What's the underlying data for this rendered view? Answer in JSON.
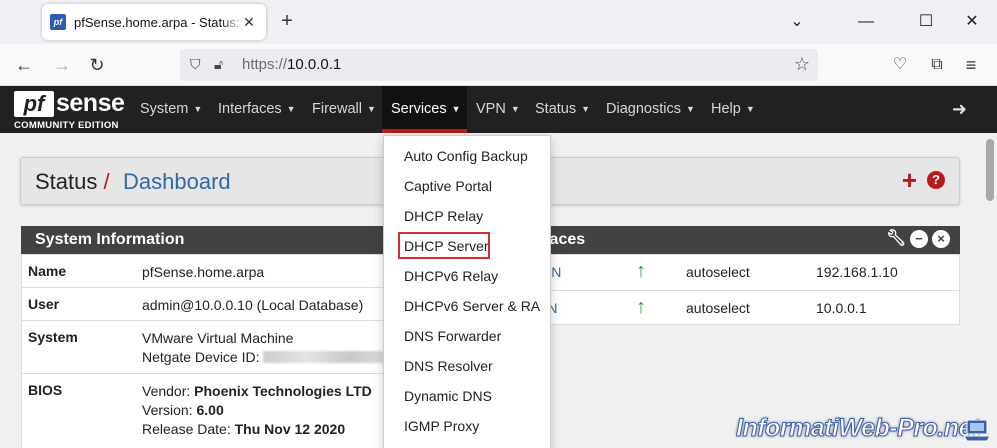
{
  "browser": {
    "tab_title": "pfSense.home.arpa - Status: Dashboard",
    "favicon_text": "pf",
    "url_proto": "https://",
    "url_host": "10.0.0.1",
    "icons": [
      "back-icon",
      "forward-icon",
      "reload-icon",
      "shield-icon",
      "lock-icon",
      "star-icon",
      "pocket-icon",
      "extensions-icon",
      "menu-icon"
    ]
  },
  "logo": {
    "pf": "pf",
    "sense": "sense",
    "edition": "COMMUNITY EDITION"
  },
  "nav": {
    "items": [
      "System",
      "Interfaces",
      "Firewall",
      "Services",
      "VPN",
      "Status",
      "Diagnostics",
      "Help"
    ],
    "active": "Services"
  },
  "breadcrumb": {
    "section": "Status",
    "separator": "/",
    "page": "Dashboard"
  },
  "system_info": {
    "title": "System Information",
    "rows": [
      {
        "label": "Name",
        "value": "pfSense.home.arpa"
      },
      {
        "label": "User",
        "value": "admin@10.0.0.10 (Local Database)"
      },
      {
        "label": "System",
        "line1": "VMware Virtual Machine",
        "line2": "Netgate Device ID:"
      },
      {
        "label": "BIOS",
        "vendor_label": "Vendor: ",
        "vendor": "Phoenix Technologies LTD",
        "version_label": "Version: ",
        "version": "6.00",
        "release_label": "Release Date: ",
        "release": "Thu Nov 12 2020"
      }
    ]
  },
  "interfaces": {
    "title": "Interfaces",
    "title_visible": "rfaces",
    "rows": [
      {
        "name": "WAN",
        "name_visible": "/AN",
        "media": "autoselect",
        "ip": "192.168.1.10"
      },
      {
        "name": "LAN",
        "name_visible": "AN",
        "media": "autoselect",
        "ip": "10.0.0.1"
      }
    ]
  },
  "services_menu": {
    "items": [
      "Auto Config Backup",
      "Captive Portal",
      "DHCP Relay",
      "DHCP Server",
      "DHCPv6 Relay",
      "DHCPv6 Server & RA",
      "DNS Forwarder",
      "DNS Resolver",
      "Dynamic DNS",
      "IGMP Proxy"
    ],
    "highlighted": "DHCP Server"
  },
  "watermark": "InformatiWeb-Pro.net",
  "colors": {
    "nav_bg": "#212121",
    "accent_red": "#b71c1c",
    "link_blue": "#3367a8",
    "status_green": "#2e9b3a"
  }
}
